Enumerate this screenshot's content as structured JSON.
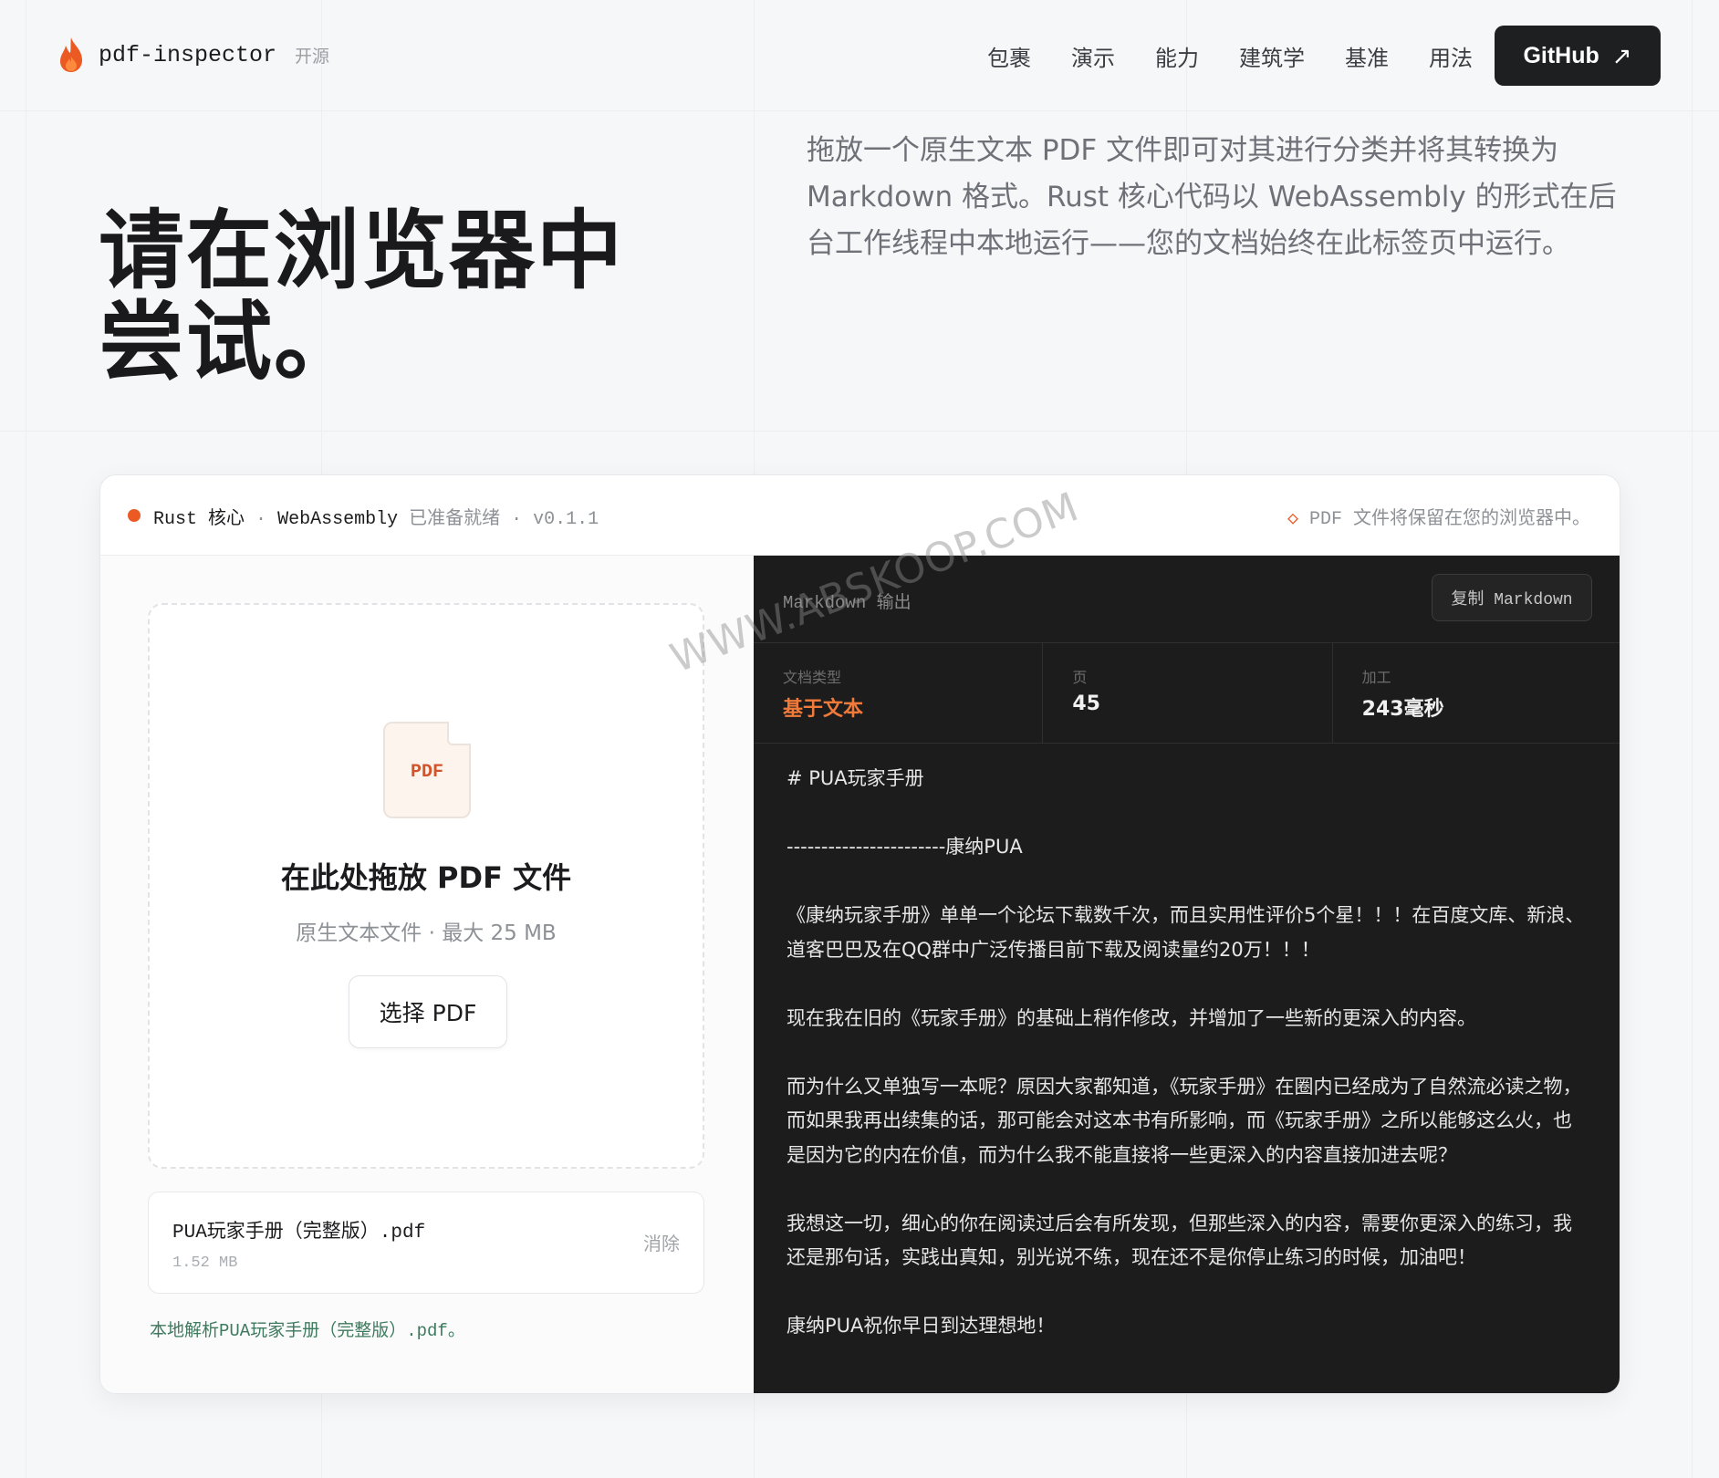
{
  "header": {
    "brand_name": "pdf-inspector",
    "brand_tag": "开源",
    "nav": [
      "包裹",
      "演示",
      "能力",
      "建筑学",
      "基准",
      "用法"
    ],
    "github_label": "GitHub",
    "github_icon": "arrow-up-right-icon"
  },
  "hero": {
    "title": "请在浏览器中尝试。",
    "description": "拖放一个原生文本 PDF 文件即可对其进行分类并将其转换为 Markdown 格式。Rust 核心代码以 WebAssembly 的形式在后台工作线程中本地运行——您的文档始终在此标签页中运行。"
  },
  "status": {
    "core": "Rust 核心",
    "separator": "·",
    "engine": "WebAssembly",
    "ready": "已准备就绪",
    "version": "v0.1.1",
    "privacy": "PDF 文件将保留在您的浏览器中。",
    "dot_color": "#ec5a24"
  },
  "upload": {
    "file_icon_label": "PDF",
    "drop_title": "在此处拖放 PDF 文件",
    "drop_subtitle": "原生文本文件 · 最大 25 MB",
    "choose_button": "选择 PDF",
    "file": {
      "name": "PUA玩家手册（完整版）.pdf",
      "size": "1.52 MB",
      "remove_label": "消除"
    },
    "parse_message": "本地解析PUA玩家手册（完整版）.pdf。"
  },
  "output": {
    "title": "Markdown 输出",
    "copy_button": "复制 Markdown",
    "stats": [
      {
        "label": "文档类型",
        "value": "基于文本",
        "accent": true
      },
      {
        "label": "页",
        "value": "45",
        "accent": false
      },
      {
        "label": "加工",
        "value": "243毫秒",
        "accent": false
      }
    ],
    "markdown": [
      "# PUA玩家手册",
      "-----------------------康纳PUA",
      "《康纳玩家手册》单单一个论坛下载数千次，而且实用性评价5个星！！！在百度文库、新浪、道客巴巴及在QQ群中广泛传播目前下载及阅读量约20万！！！",
      "现在我在旧的《玩家手册》的基础上稍作修改，并增加了一些新的更深入的内容。",
      "而为什么又单独写一本呢？原因大家都知道，《玩家手册》在圈内已经成为了自然流必读之物，而如果我再出续集的话，那可能会对这本书有所影响，而《玩家手册》之所以能够这么火，也是因为它的内在价值，而为什么我不能直接将一些更深入的内容直接加进去呢？",
      "我想这一切，细心的你在阅读过后会有所发现，但那些深入的内容，需要你更深入的练习，我还是那句话，实践出真知，别光说不练，现在还不是你停止练习的时候，加油吧！",
      "康纳PUA祝你早日到达理想地！"
    ]
  },
  "watermark": "WWW.ABSKOOP.COM",
  "colors": {
    "accent": "#ec5a24",
    "dark_panel": "#1c1c1c",
    "success_text": "#3e7a5e"
  }
}
